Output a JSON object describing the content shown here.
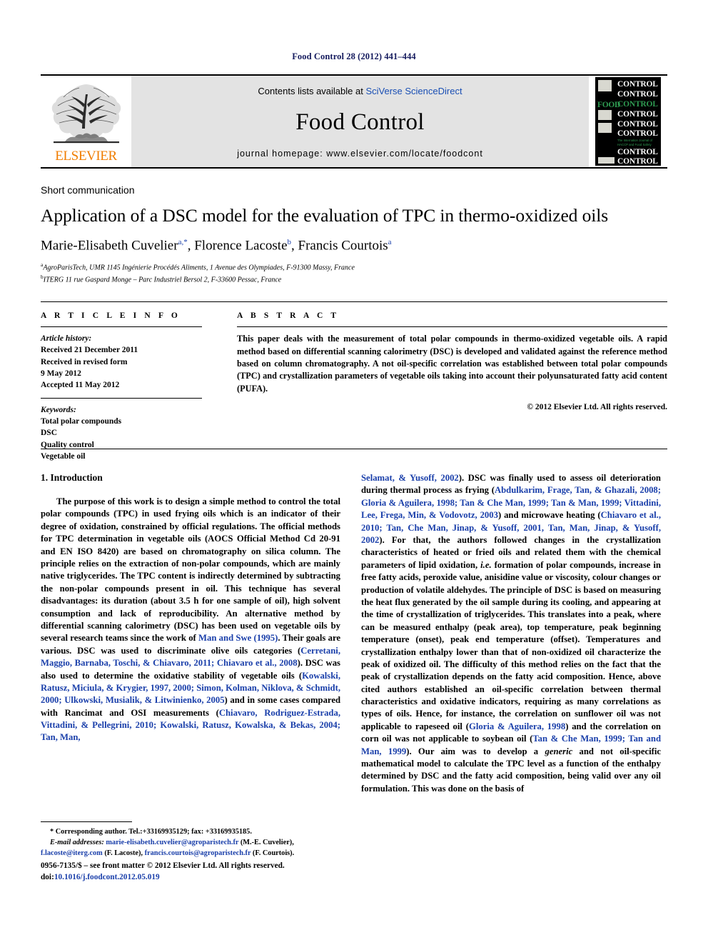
{
  "running_head": "Food Control 28 (2012) 441–444",
  "masthead": {
    "publisher": "ELSEVIER",
    "contents_prefix": "Contents lists available at ",
    "contents_link": "SciVerse ScienceDirect",
    "journal_name": "Food Control",
    "homepage": "journal homepage: www.elsevier.com/locate/foodcont",
    "cover": {
      "word": "CONTROL",
      "food_word": "FOOD",
      "tagline": "The Internation Journal of HACCP and Food Safety"
    }
  },
  "article": {
    "type_label": "Short communication",
    "title": "Application of a DSC model for the evaluation of TPC in thermo-oxidized oils",
    "authors": [
      {
        "name": "Marie-Elisabeth Cuvelier",
        "sup": "a,*"
      },
      {
        "name": "Florence Lacoste",
        "sup": "b"
      },
      {
        "name": "Francis Courtois",
        "sup": "a"
      }
    ],
    "affiliations": [
      {
        "marker": "a",
        "text": "AgroParisTech, UMR 1145 Ingénierie Procédés Aliments, 1 Avenue des Olympiades, F-91300 Massy, France"
      },
      {
        "marker": "b",
        "text": "ITERG 11 rue Gaspard Monge – Parc Industriel Bersol 2, F-33600 Pessac, France"
      }
    ]
  },
  "info": {
    "heading": "A R T I C L E   I N F O",
    "history_label": "Article history:",
    "history": [
      "Received 21 December 2011",
      "Received in revised form",
      "9 May 2012",
      "Accepted 11 May 2012"
    ],
    "keywords_label": "Keywords:",
    "keywords": [
      "Total polar compounds",
      "DSC",
      "Quality control",
      "Vegetable oil"
    ]
  },
  "abstract": {
    "heading": "A B S T R A C T",
    "text": "This paper deals with the measurement of total polar compounds in thermo-oxidized vegetable oils. A rapid method based on differential scanning calorimetry (DSC) is developed and validated against the reference method based on column chromatography. A not oil-specific correlation was established between total polar compounds (TPC) and crystallization parameters of vegetable oils taking into account their polyunsaturated fatty acid content (PUFA).",
    "copyright": "© 2012 Elsevier Ltd. All rights reserved."
  },
  "body": {
    "section_number_title": "1.  Introduction",
    "left_column_paragraph": "The purpose of this work is to design a simple method to control the total polar compounds (TPC) in used frying oils which is an indicator of their degree of oxidation, constrained by official regulations. The official methods for TPC determination in vegetable oils (AOCS Official Method Cd 20-91 and EN ISO 8420) are based on chromatography on silica column. The principle relies on the extraction of non-polar compounds, which are mainly native triglycerides. The TPC content is indirectly determined by subtracting the non-polar compounds present in oil. This technique has several disadvantages: its duration (about 3.5 h for one sample of oil), high solvent consumption and lack of reproducibility. An alternative method by differential scanning calorimetry (DSC) has been used on vegetable oils by several research teams since the work of ",
    "left_cite_1": "Man and Swe (1995)",
    "left_text_2": ". Their goals are various. DSC was used to discriminate olive oils categories (",
    "left_cite_2": "Cerretani, Maggio, Barnaba, Toschi, & Chiavaro, 2011; Chiavaro et al., 2008",
    "left_text_3": "). DSC was also used to determine the oxidative stability of vegetable oils (",
    "left_cite_3": "Kowalski, Ratusz, Miciula, & Krygier, 1997, 2000; Simon, Kolman, Niklova, & Schmidt, 2000; Ulkowski, Musialik, & Litwinienko, 2005",
    "left_text_4": ") and in some cases compared with Rancimat and OSI measurements (",
    "left_cite_4": "Chiavaro, Rodriguez-Estrada, Vittadini, & Pellegrini, 2010; Kowalski, Ratusz, Kowalska, & Bekas, 2004; Tan, Man,",
    "right_cite_1": "Selamat, & Yusoff, 2002",
    "right_text_1": "). DSC was finally used to assess oil deterioration during thermal process as frying (",
    "right_cite_2": "Abdulkarim, Frage, Tan, & Ghazali, 2008; Gloria & Aguilera, 1998; Tan & Che Man, 1999; Tan & Man, 1999; Vittadini, Lee, Frega, Min, & Vodovotz, 2003",
    "right_text_2": ") and microwave heating (",
    "right_cite_3": "Chiavaro et al., 2010; Tan, Che Man, Jinap, & Yusoff, 2001, Tan, Man, Jinap, & Yusoff, 2002",
    "right_text_3": "). For that, the authors followed changes in the crystallization characteristics of heated or fried oils and related them with the chemical parameters of lipid oxidation, ",
    "right_italic_1": "i.e.",
    "right_text_4": " formation of polar compounds, increase in free fatty acids, peroxide value, anisidine value or viscosity, colour changes or production of volatile aldehydes. The principle of DSC is based on measuring the heat flux generated by the oil sample during its cooling, and appearing at the time of crystallization of triglycerides. This translates into a peak, where can be measured enthalpy (peak area), top temperature, peak beginning temperature (onset), peak end temperature (offset). Temperatures and crystallization enthalpy lower than that of non-oxidized oil characterize the peak of oxidized oil. The difficulty of this method relies on the fact that the peak of crystallization depends on the fatty acid composition. Hence, above cited authors established an oil-specific correlation between thermal characteristics and oxidative indicators, requiring as many correlations as types of oils. Hence, for instance, the correlation on sunflower oil was not applicable to rapeseed oil (",
    "right_cite_4": "Gloria & Aguilera, 1998",
    "right_text_5": ") and the correlation on corn oil was not applicable to soybean oil (",
    "right_cite_5": "Tan & Che Man, 1999; Tan and Man, 1999",
    "right_text_6": "). Our aim was to develop a ",
    "right_italic_2": "generic",
    "right_text_7": " and not oil-specific mathematical model to calculate the TPC level as a function of the enthalpy determined by DSC and the fatty acid composition, being valid over any oil formulation. This was done on the basis of"
  },
  "footnote": {
    "corresponding": "* Corresponding author. Tel.:+33169935129; fax: +33169935185.",
    "email_label": "E-mail addresses:",
    "email_1": "marie-elisabeth.cuvelier@agroparistech.fr",
    "email_1_owner": " (M.-E. Cuvelier),",
    "email_2": "f.lacoste@iterg.com",
    "email_2_owner": " (F. Lacoste), ",
    "email_3": "francis.courtois@agroparistech.fr",
    "email_3_owner": " (F. Courtois)."
  },
  "footer": {
    "issn_line": "0956-7135/$ – see front matter © 2012 Elsevier Ltd. All rights reserved.",
    "doi_label": "doi:",
    "doi_value": "10.1016/j.foodcont.2012.05.019"
  }
}
